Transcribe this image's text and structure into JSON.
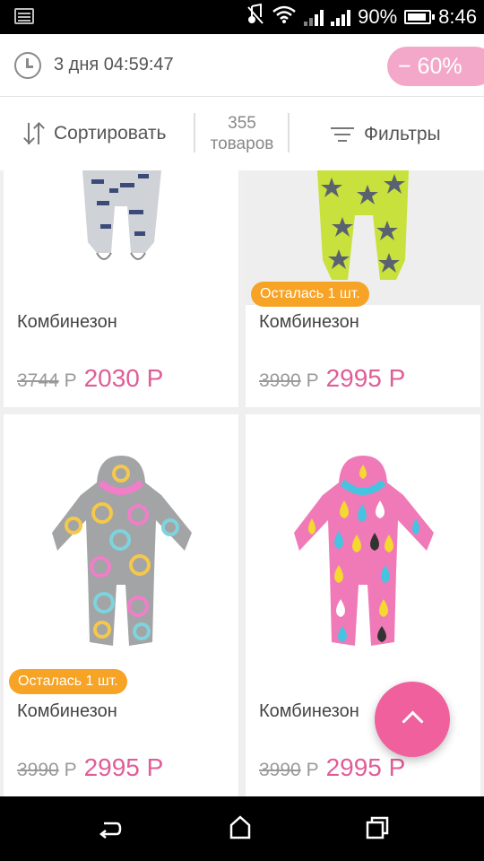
{
  "status_bar": {
    "battery": "90%",
    "time": "8:46"
  },
  "timer": {
    "text": "3 дня 04:59:47",
    "discount": "− 60%"
  },
  "toolbar": {
    "sort_label": "Сортировать",
    "count_number": "355",
    "count_unit": "товаров",
    "filter_label": "Фильтры"
  },
  "currency": "Р",
  "products": [
    {
      "title": "Комбинезон",
      "old_price": "3744",
      "new_price": "2030 Р",
      "badge": "",
      "colors": {
        "bg": "#ffffff",
        "body": "#cfd2d6",
        "pattern": "#3c4a7a"
      }
    },
    {
      "title": "Комбинезон",
      "old_price": "3990",
      "new_price": "2995 Р",
      "badge": "Осталась 1 шт.",
      "colors": {
        "bg": "#eeeeee",
        "body": "#c8e13c",
        "pattern": "#5a6270"
      }
    },
    {
      "title": "Комбинезон",
      "old_price": "3990",
      "new_price": "2995 Р",
      "badge": "Осталась 1 шт.",
      "colors": {
        "bg": "#ffffff",
        "body": "#9a9a9a",
        "pattern": "#f4c84a",
        "hood": "#f07ec8"
      }
    },
    {
      "title": "Комбинезон",
      "old_price": "3990",
      "new_price": "2995 Р",
      "badge": "",
      "colors": {
        "bg": "#ffffff",
        "body": "#f07ab8",
        "pattern": "#f5d830",
        "hood": "#45c3e0"
      }
    }
  ],
  "colors": {
    "accent": "#e05d98",
    "badge": "#f7a325",
    "discount": "#f4a8c9",
    "fab": "#f0609c"
  }
}
